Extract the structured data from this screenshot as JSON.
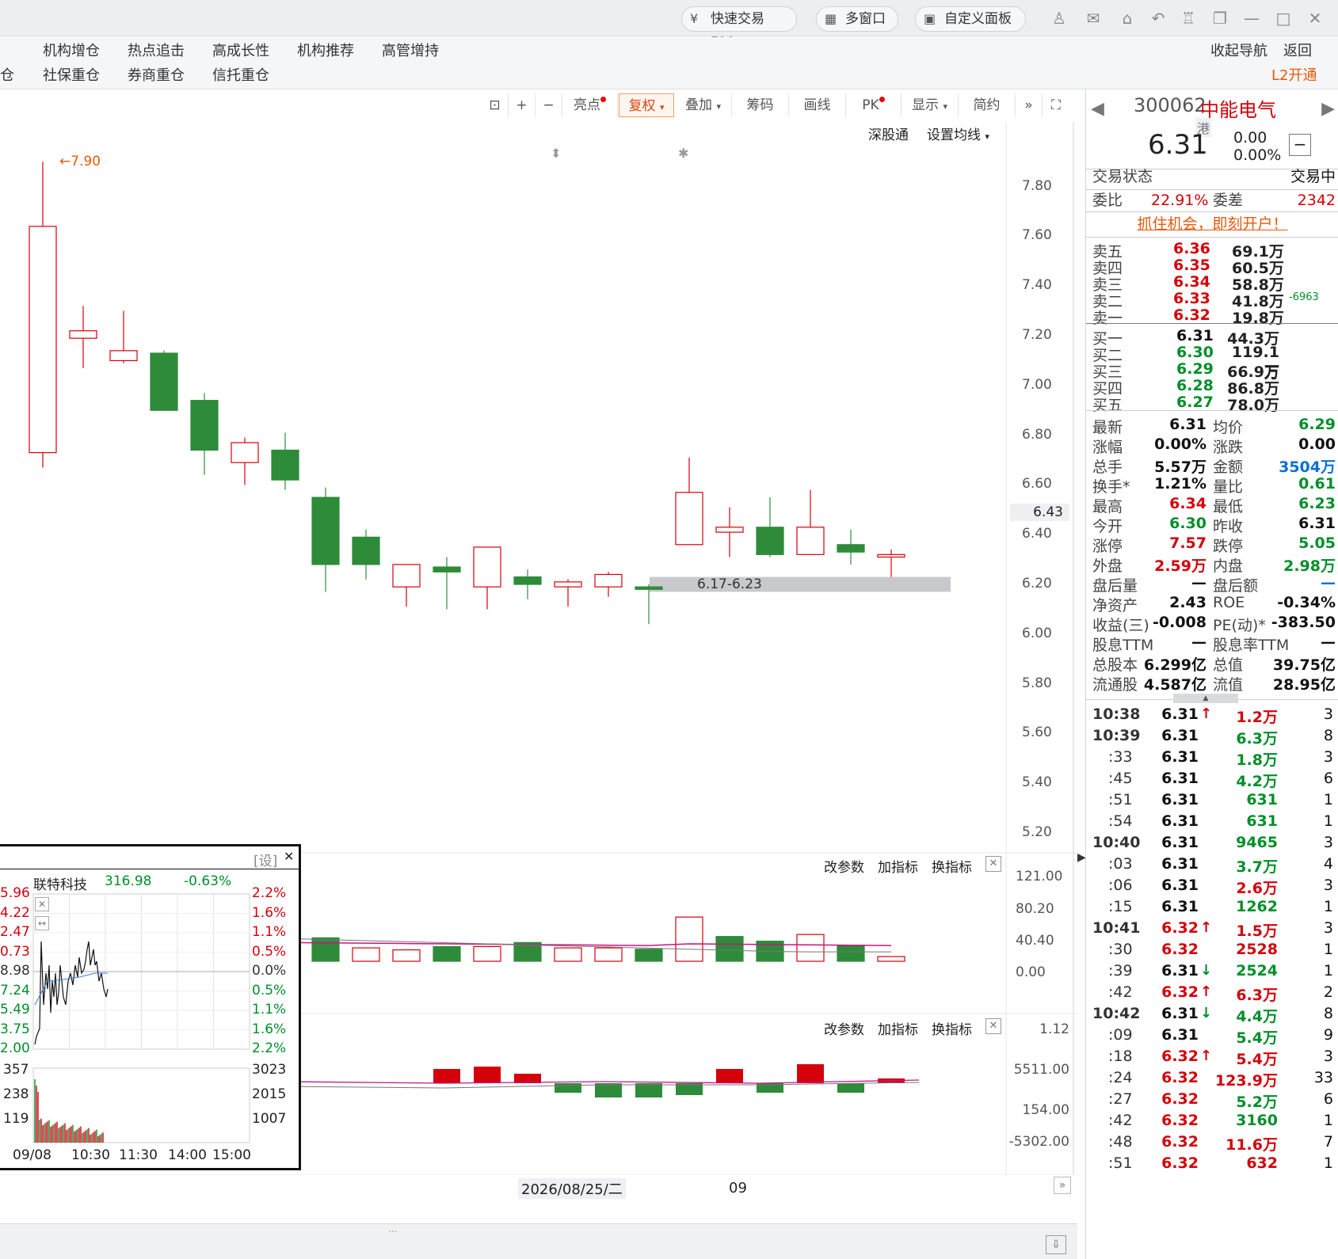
{
  "topbar": {
    "quick_trade": "快速交易F12",
    "multi_window": "多窗口",
    "custom_panel": "自定义面板"
  },
  "nav": {
    "row1": [
      "机构增仓",
      "热点追击",
      "高成长性",
      "机构推荐",
      "高管增持"
    ],
    "row2": [
      "社保重仓",
      "券商重仓",
      "信托重仓"
    ],
    "row2_prefix": "仓",
    "collapse": "收起导航",
    "back": "返回",
    "l2": "L2开通"
  },
  "toolbar": {
    "highlight": "亮点",
    "restore": "复权",
    "overlay": "叠加",
    "chips": "筹码",
    "draw": "画线",
    "pk": "PK",
    "display": "显示",
    "simple": "简约",
    "shenguto": "深股通",
    "set_ma": "设置均线"
  },
  "kline": {
    "high_label": "7.90",
    "price_axis": [
      "7.80",
      "7.60",
      "7.40",
      "7.20",
      "7.00",
      "6.80",
      "6.60",
      "6.40",
      "6.20",
      "6.00",
      "5.80",
      "5.60",
      "5.40",
      "5.20"
    ],
    "current_price_tag": "6.43",
    "zone_label": "6.17-6.23",
    "ylim": [
      5.13,
      8.06
    ],
    "candles": [
      {
        "o": 6.73,
        "c": 7.64,
        "h": 7.9,
        "l": 6.67,
        "up": true
      },
      {
        "o": 7.19,
        "c": 7.22,
        "h": 7.32,
        "l": 7.07,
        "up": true
      },
      {
        "o": 7.1,
        "c": 7.14,
        "h": 7.3,
        "l": 7.09,
        "up": true
      },
      {
        "o": 7.13,
        "c": 6.9,
        "h": 7.14,
        "l": 6.9,
        "up": false
      },
      {
        "o": 6.94,
        "c": 6.74,
        "h": 6.97,
        "l": 6.64,
        "up": false
      },
      {
        "o": 6.69,
        "c": 6.77,
        "h": 6.79,
        "l": 6.6,
        "up": true
      },
      {
        "o": 6.74,
        "c": 6.62,
        "h": 6.81,
        "l": 6.58,
        "up": false
      },
      {
        "o": 6.55,
        "c": 6.28,
        "h": 6.59,
        "l": 6.17,
        "up": false
      },
      {
        "o": 6.39,
        "c": 6.28,
        "h": 6.42,
        "l": 6.22,
        "up": false
      },
      {
        "o": 6.19,
        "c": 6.28,
        "h": 6.28,
        "l": 6.11,
        "up": true
      },
      {
        "o": 6.27,
        "c": 6.25,
        "h": 6.31,
        "l": 6.1,
        "up": false
      },
      {
        "o": 6.19,
        "c": 6.35,
        "h": 6.35,
        "l": 6.1,
        "up": true
      },
      {
        "o": 6.23,
        "c": 6.2,
        "h": 6.26,
        "l": 6.14,
        "up": false
      },
      {
        "o": 6.19,
        "c": 6.21,
        "h": 6.22,
        "l": 6.11,
        "up": true
      },
      {
        "o": 6.19,
        "c": 6.24,
        "h": 6.25,
        "l": 6.15,
        "up": true
      },
      {
        "o": 6.19,
        "c": 6.18,
        "h": 6.2,
        "l": 6.04,
        "up": false
      },
      {
        "o": 6.36,
        "c": 6.57,
        "h": 6.71,
        "l": 6.36,
        "up": true
      },
      {
        "o": 6.41,
        "c": 6.43,
        "h": 6.51,
        "l": 6.31,
        "up": true
      },
      {
        "o": 6.43,
        "c": 6.32,
        "h": 6.55,
        "l": 6.31,
        "up": false
      },
      {
        "o": 6.32,
        "c": 6.43,
        "h": 6.58,
        "l": 6.32,
        "up": true
      },
      {
        "o": 6.36,
        "c": 6.33,
        "h": 6.42,
        "l": 6.28,
        "up": false
      },
      {
        "o": 6.31,
        "c": 6.32,
        "h": 6.34,
        "l": 6.23,
        "up": true
      }
    ]
  },
  "vol_panel": {
    "axis": [
      "121.00",
      "80.20",
      "40.40",
      "0.00"
    ],
    "ylim": [
      0,
      130
    ],
    "edit": "改参数",
    "add": "加指标",
    "swap": "换指标",
    "bars": [
      0,
      0,
      0,
      0,
      0,
      0,
      35,
      35,
      20,
      17,
      22,
      22,
      28,
      20,
      20,
      18,
      66,
      37,
      30,
      40,
      24,
      7
    ],
    "up": [
      true,
      true,
      true,
      false,
      false,
      true,
      false,
      false,
      true,
      true,
      false,
      true,
      false,
      true,
      true,
      false,
      true,
      false,
      false,
      true,
      false,
      true
    ]
  },
  "macd_panel": {
    "axis": [
      "1.12",
      "5511.00",
      "154.00",
      "-5302.00"
    ],
    "edit": "改参数",
    "add": "加指标",
    "swap": "换指标"
  },
  "date_axis": {
    "center_label": "2026/08/25/二",
    "right_label": "09"
  },
  "popup": {
    "set": "[设]",
    "stock_name": "联特科技",
    "price": "316.98",
    "change": "-0.63%",
    "left_axis": [
      "5.96",
      "4.22",
      "2.47",
      "0.73",
      "8.98",
      "7.24",
      "5.49",
      "3.75",
      "2.00"
    ],
    "right_axis": [
      "2.2%",
      "1.6%",
      "1.1%",
      "0.5%",
      "0.0%",
      "0.5%",
      "1.1%",
      "1.6%",
      "2.2%"
    ],
    "vol_left": [
      "357",
      "238",
      "119"
    ],
    "vol_right": [
      "3023",
      "2015",
      "1007"
    ],
    "times": [
      "09/08",
      "10:30",
      "11:30",
      "14:00",
      "15:00"
    ]
  },
  "quote": {
    "code": "300062",
    "name": "中能电气",
    "hk_tag": "港",
    "price": "6.31",
    "change": "0.00",
    "change_pct": "0.00%",
    "status_label": "交易状态",
    "status_value": "交易中",
    "weibi_label": "委比",
    "weibi": "22.91%",
    "weicha_label": "委差",
    "weicha": "2342",
    "promo": "抓住机会，即刻开户！",
    "sells": [
      {
        "label": "卖五",
        "price": "6.36",
        "vol": "69.1万",
        "extra": ""
      },
      {
        "label": "卖四",
        "price": "6.35",
        "vol": "60.5万",
        "extra": ""
      },
      {
        "label": "卖三",
        "price": "6.34",
        "vol": "58.8万",
        "extra": ""
      },
      {
        "label": "卖二",
        "price": "6.33",
        "vol": "41.8万",
        "extra": "-6963"
      },
      {
        "label": "卖一",
        "price": "6.32",
        "vol": "19.8万",
        "extra": ""
      }
    ],
    "buys": [
      {
        "label": "买一",
        "price": "6.31",
        "vol": "44.3万"
      },
      {
        "label": "买二",
        "price": "6.30",
        "vol": "119.1万"
      },
      {
        "label": "买三",
        "price": "6.29",
        "vol": "66.9万"
      },
      {
        "label": "买四",
        "price": "6.28",
        "vol": "86.8万"
      },
      {
        "label": "买五",
        "price": "6.27",
        "vol": "78.0万"
      }
    ],
    "stats": [
      {
        "l1": "最新",
        "v1": "6.31",
        "c1": "blk",
        "l2": "均价",
        "v2": "6.29",
        "c2": "grn"
      },
      {
        "l1": "涨幅",
        "v1": "0.00%",
        "c1": "blk",
        "l2": "涨跌",
        "v2": "0.00",
        "c2": "blk"
      },
      {
        "l1": "总手",
        "v1": "5.57万",
        "c1": "blk",
        "l2": "金额",
        "v2": "3504万",
        "c2": "blu"
      },
      {
        "l1": "换手*",
        "v1": "1.21%",
        "c1": "blk",
        "l2": "量比",
        "v2": "0.61",
        "c2": "grn"
      },
      {
        "l1": "最高",
        "v1": "6.34",
        "c1": "red",
        "l2": "最低",
        "v2": "6.23",
        "c2": "grn"
      },
      {
        "l1": "今开",
        "v1": "6.30",
        "c1": "grn",
        "l2": "昨收",
        "v2": "6.31",
        "c2": "blk"
      },
      {
        "l1": "涨停",
        "v1": "7.57",
        "c1": "red",
        "l2": "跌停",
        "v2": "5.05",
        "c2": "grn"
      },
      {
        "l1": "外盘",
        "v1": "2.59万",
        "c1": "red",
        "l2": "内盘",
        "v2": "2.98万",
        "c2": "grn"
      },
      {
        "l1": "盘后量",
        "v1": "—",
        "c1": "blk",
        "l2": "盘后额",
        "v2": "—",
        "c2": "blu"
      },
      {
        "l1": "净资产",
        "v1": "2.43",
        "c1": "blk",
        "l2": "ROE",
        "v2": "-0.34%",
        "c2": "blk"
      },
      {
        "l1": "收益(三)",
        "v1": "-0.008",
        "c1": "blk",
        "l2": "PE(动)*",
        "v2": "-383.50",
        "c2": "blk"
      },
      {
        "l1": "股息TTM",
        "v1": "—",
        "c1": "blk",
        "l2": "股息率TTM",
        "v2": "—",
        "c2": "blk"
      },
      {
        "l1": "总股本",
        "v1": "6.299亿",
        "c1": "blk",
        "l2": "总值",
        "v2": "39.75亿",
        "c2": "blk"
      },
      {
        "l1": "流通股",
        "v1": "4.587亿",
        "c1": "blk",
        "l2": "流值",
        "v2": "28.95亿",
        "c2": "blk"
      }
    ],
    "ticks": [
      {
        "t": "10:38",
        "p": "6.31",
        "pc": "blk",
        "arrow": "up",
        "v": "1.2万",
        "vc": "red",
        "n": "3",
        "bold": true
      },
      {
        "t": "10:39",
        "p": "6.31",
        "pc": "blk",
        "arrow": "",
        "v": "6.3万",
        "vc": "grn",
        "n": "8",
        "bold": true
      },
      {
        "t": ":33",
        "p": "6.31",
        "pc": "blk",
        "arrow": "",
        "v": "1.8万",
        "vc": "grn",
        "n": "3",
        "bold": false
      },
      {
        "t": ":45",
        "p": "6.31",
        "pc": "blk",
        "arrow": "",
        "v": "4.2万",
        "vc": "grn",
        "n": "6",
        "bold": false
      },
      {
        "t": ":51",
        "p": "6.31",
        "pc": "blk",
        "arrow": "",
        "v": "631",
        "vc": "grn",
        "n": "1",
        "bold": false
      },
      {
        "t": ":54",
        "p": "6.31",
        "pc": "blk",
        "arrow": "",
        "v": "631",
        "vc": "grn",
        "n": "1",
        "bold": false
      },
      {
        "t": "10:40",
        "p": "6.31",
        "pc": "blk",
        "arrow": "",
        "v": "9465",
        "vc": "grn",
        "n": "3",
        "bold": true
      },
      {
        "t": ":03",
        "p": "6.31",
        "pc": "blk",
        "arrow": "",
        "v": "3.7万",
        "vc": "grn",
        "n": "4",
        "bold": false
      },
      {
        "t": ":06",
        "p": "6.31",
        "pc": "blk",
        "arrow": "",
        "v": "2.6万",
        "vc": "red",
        "n": "3",
        "bold": false
      },
      {
        "t": ":15",
        "p": "6.31",
        "pc": "blk",
        "arrow": "",
        "v": "1262",
        "vc": "grn",
        "n": "1",
        "bold": false
      },
      {
        "t": "10:41",
        "p": "6.32",
        "pc": "red",
        "arrow": "up",
        "v": "1.5万",
        "vc": "red",
        "n": "3",
        "bold": true
      },
      {
        "t": ":30",
        "p": "6.32",
        "pc": "red",
        "arrow": "",
        "v": "2528",
        "vc": "red",
        "n": "1",
        "bold": false
      },
      {
        "t": ":39",
        "p": "6.31",
        "pc": "blk",
        "arrow": "down",
        "v": "2524",
        "vc": "grn",
        "n": "1",
        "bold": false
      },
      {
        "t": ":42",
        "p": "6.32",
        "pc": "red",
        "arrow": "up",
        "v": "6.3万",
        "vc": "red",
        "n": "2",
        "bold": false
      },
      {
        "t": "10:42",
        "p": "6.31",
        "pc": "blk",
        "arrow": "down",
        "v": "4.4万",
        "vc": "grn",
        "n": "8",
        "bold": true
      },
      {
        "t": ":09",
        "p": "6.31",
        "pc": "blk",
        "arrow": "",
        "v": "5.4万",
        "vc": "grn",
        "n": "9",
        "bold": false
      },
      {
        "t": ":18",
        "p": "6.32",
        "pc": "red",
        "arrow": "up",
        "v": "5.4万",
        "vc": "red",
        "n": "3",
        "bold": false
      },
      {
        "t": ":24",
        "p": "6.32",
        "pc": "red",
        "arrow": "",
        "v": "123.9万",
        "vc": "red",
        "n": "33",
        "bold": false
      },
      {
        "t": ":27",
        "p": "6.32",
        "pc": "red",
        "arrow": "",
        "v": "5.2万",
        "vc": "grn",
        "n": "6",
        "bold": false
      },
      {
        "t": ":42",
        "p": "6.32",
        "pc": "red",
        "arrow": "",
        "v": "3160",
        "vc": "grn",
        "n": "1",
        "bold": false
      },
      {
        "t": ":48",
        "p": "6.32",
        "pc": "red",
        "arrow": "",
        "v": "11.6万",
        "vc": "red",
        "n": "7",
        "bold": false
      },
      {
        "t": ":51",
        "p": "6.32",
        "pc": "red",
        "arrow": "",
        "v": "632",
        "vc": "red",
        "n": "1",
        "bold": false
      }
    ]
  },
  "colors": {
    "up": "#d4000a",
    "down": "#2e8b3a",
    "accent": "#e8590c"
  }
}
